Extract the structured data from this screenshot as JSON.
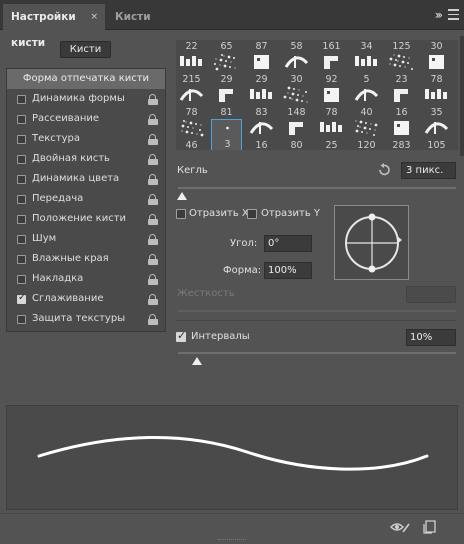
{
  "tabs": {
    "active_label": "Настройки кисти",
    "inactive_label": "Кисти",
    "close_glyph": "×"
  },
  "brushes_button": "Кисти",
  "brush_tip_shape": "Форма отпечатка кисти",
  "options": [
    {
      "label": "Динамика формы",
      "checked": false
    },
    {
      "label": "Рассеивание",
      "checked": false
    },
    {
      "label": "Текстура",
      "checked": false
    },
    {
      "label": "Двойная кисть",
      "checked": false
    },
    {
      "label": "Динамика цвета",
      "checked": false
    },
    {
      "label": "Передача",
      "checked": false
    },
    {
      "label": "Положение кисти",
      "checked": false
    },
    {
      "label": "Шум",
      "checked": false
    },
    {
      "label": "Влажные края",
      "checked": false
    },
    {
      "label": "Накладка",
      "checked": false
    },
    {
      "label": "Сглаживание",
      "checked": true
    },
    {
      "label": "Защита текстуры",
      "checked": false
    }
  ],
  "presets": {
    "top_numbers": [
      "22",
      "65",
      "87",
      "58",
      "161",
      "34",
      "125",
      "30"
    ],
    "rows": [
      [
        "215",
        "29",
        "29",
        "30",
        "92",
        "5",
        "23",
        "78"
      ],
      [
        "78",
        "81",
        "83",
        "148",
        "78",
        "40",
        "16",
        "35"
      ],
      [
        "46",
        "3",
        "16",
        "80",
        "25",
        "120",
        "283",
        "105"
      ]
    ],
    "selected": "3"
  },
  "size": {
    "label": "Кегль",
    "value": "3 пикс.",
    "slider_fraction": 0.01
  },
  "flip_x": {
    "label": "Отразить X",
    "checked": false
  },
  "flip_y": {
    "label": "Отразить Y",
    "checked": false
  },
  "angle": {
    "label": "Угол:",
    "value": "0°"
  },
  "roundness": {
    "label": "Форма:",
    "value": "100%"
  },
  "hardness": {
    "label": "Жесткость",
    "value": ""
  },
  "spacing": {
    "label": "Интервалы",
    "checked": true,
    "value": "10%",
    "slider_fraction": 0.1
  },
  "colors": {
    "panel_bg": "#535353",
    "tabbar_bg": "#383838",
    "selection_accent": "#4aa3df",
    "field_bg": "#3b3b3b"
  },
  "icons": {
    "reset": "reset-icon",
    "toggle_preview": "eye-brush-icon",
    "new_preset": "new-preset-icon",
    "panel_menu": "hamburger-menu-icon",
    "collapse": "double-chevron-icon"
  }
}
